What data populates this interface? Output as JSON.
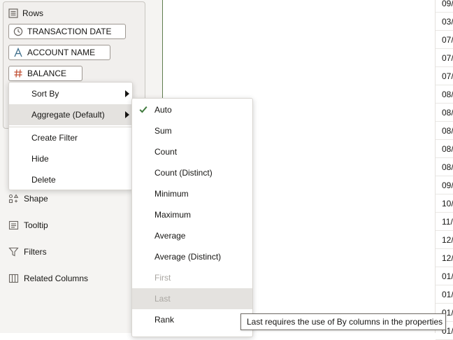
{
  "rows_panel": {
    "title": "Rows",
    "chips": [
      {
        "label": "TRANSACTION DATE",
        "icon": "clock-icon"
      },
      {
        "label": "ACCOUNT NAME",
        "icon": "text-type-icon"
      },
      {
        "label": "BALANCE",
        "icon": "hash-icon"
      }
    ]
  },
  "side_items": [
    {
      "label": "Shape",
      "icon": "shape-icon"
    },
    {
      "label": "Tooltip",
      "icon": "tooltip-icon"
    },
    {
      "label": "Filters",
      "icon": "filter-icon"
    },
    {
      "label": "Related Columns",
      "icon": "columns-icon"
    }
  ],
  "context_menu": {
    "items": [
      {
        "label": "Sort By"
      },
      {
        "label": "Aggregate (Default)"
      },
      {
        "label": "Create Filter"
      },
      {
        "label": "Hide"
      },
      {
        "label": "Delete"
      }
    ]
  },
  "aggregate_menu": {
    "items": [
      {
        "label": "Auto",
        "checked": true
      },
      {
        "label": "Sum"
      },
      {
        "label": "Count"
      },
      {
        "label": "Count (Distinct)"
      },
      {
        "label": "Minimum"
      },
      {
        "label": "Maximum"
      },
      {
        "label": "Average"
      },
      {
        "label": "Average (Distinct)"
      },
      {
        "label": "First",
        "disabled": true
      },
      {
        "label": "Last",
        "disabled": true
      },
      {
        "label": "Rank"
      }
    ]
  },
  "tooltip": {
    "text": "Last requires the use of By columns in the properties"
  },
  "table_cells": [
    "09/",
    "03/",
    "07/",
    "07/",
    "07/",
    "08/",
    "08/",
    "08/",
    "08/",
    "08/",
    "09/",
    "10/",
    "11/",
    "12/",
    "12/",
    "01/",
    "01/",
    "01/",
    "01/"
  ],
  "colors": {
    "accent_check": "#3f7a3d",
    "clock_icon": "#6a6561",
    "text_icon": "#3d6d8a",
    "hash_icon": "#c2553a"
  }
}
